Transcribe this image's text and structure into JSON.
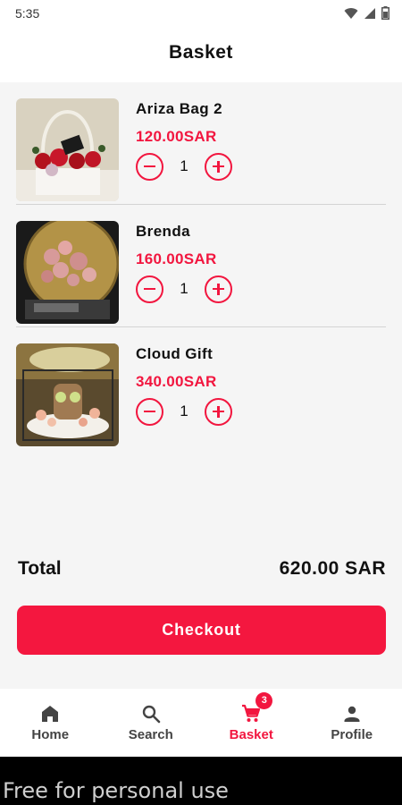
{
  "status_bar": {
    "time": "5:35"
  },
  "app_bar": {
    "title": "Basket"
  },
  "basket_items": [
    {
      "name": "Ariza Bag 2",
      "price": "120.00SAR",
      "quantity": "1"
    },
    {
      "name": "Brenda",
      "price": "160.00SAR",
      "quantity": "1"
    },
    {
      "name": "Cloud Gift",
      "price": "340.00SAR",
      "quantity": "1"
    }
  ],
  "summary": {
    "total_label": "Total",
    "total_value": "620.00 SAR"
  },
  "checkout": {
    "label": "Checkout"
  },
  "bottom_nav": {
    "items": [
      {
        "label": "Home",
        "icon": "home-icon"
      },
      {
        "label": "Search",
        "icon": "search-icon"
      },
      {
        "label": "Basket",
        "icon": "cart-icon",
        "badge": "3",
        "active": true
      },
      {
        "label": "Profile",
        "icon": "person-icon"
      }
    ]
  },
  "footer": {
    "text": "Free for personal use"
  },
  "colors": {
    "accent": "#f2163f",
    "background": "#f5f5f5",
    "surface": "#ffffff"
  }
}
